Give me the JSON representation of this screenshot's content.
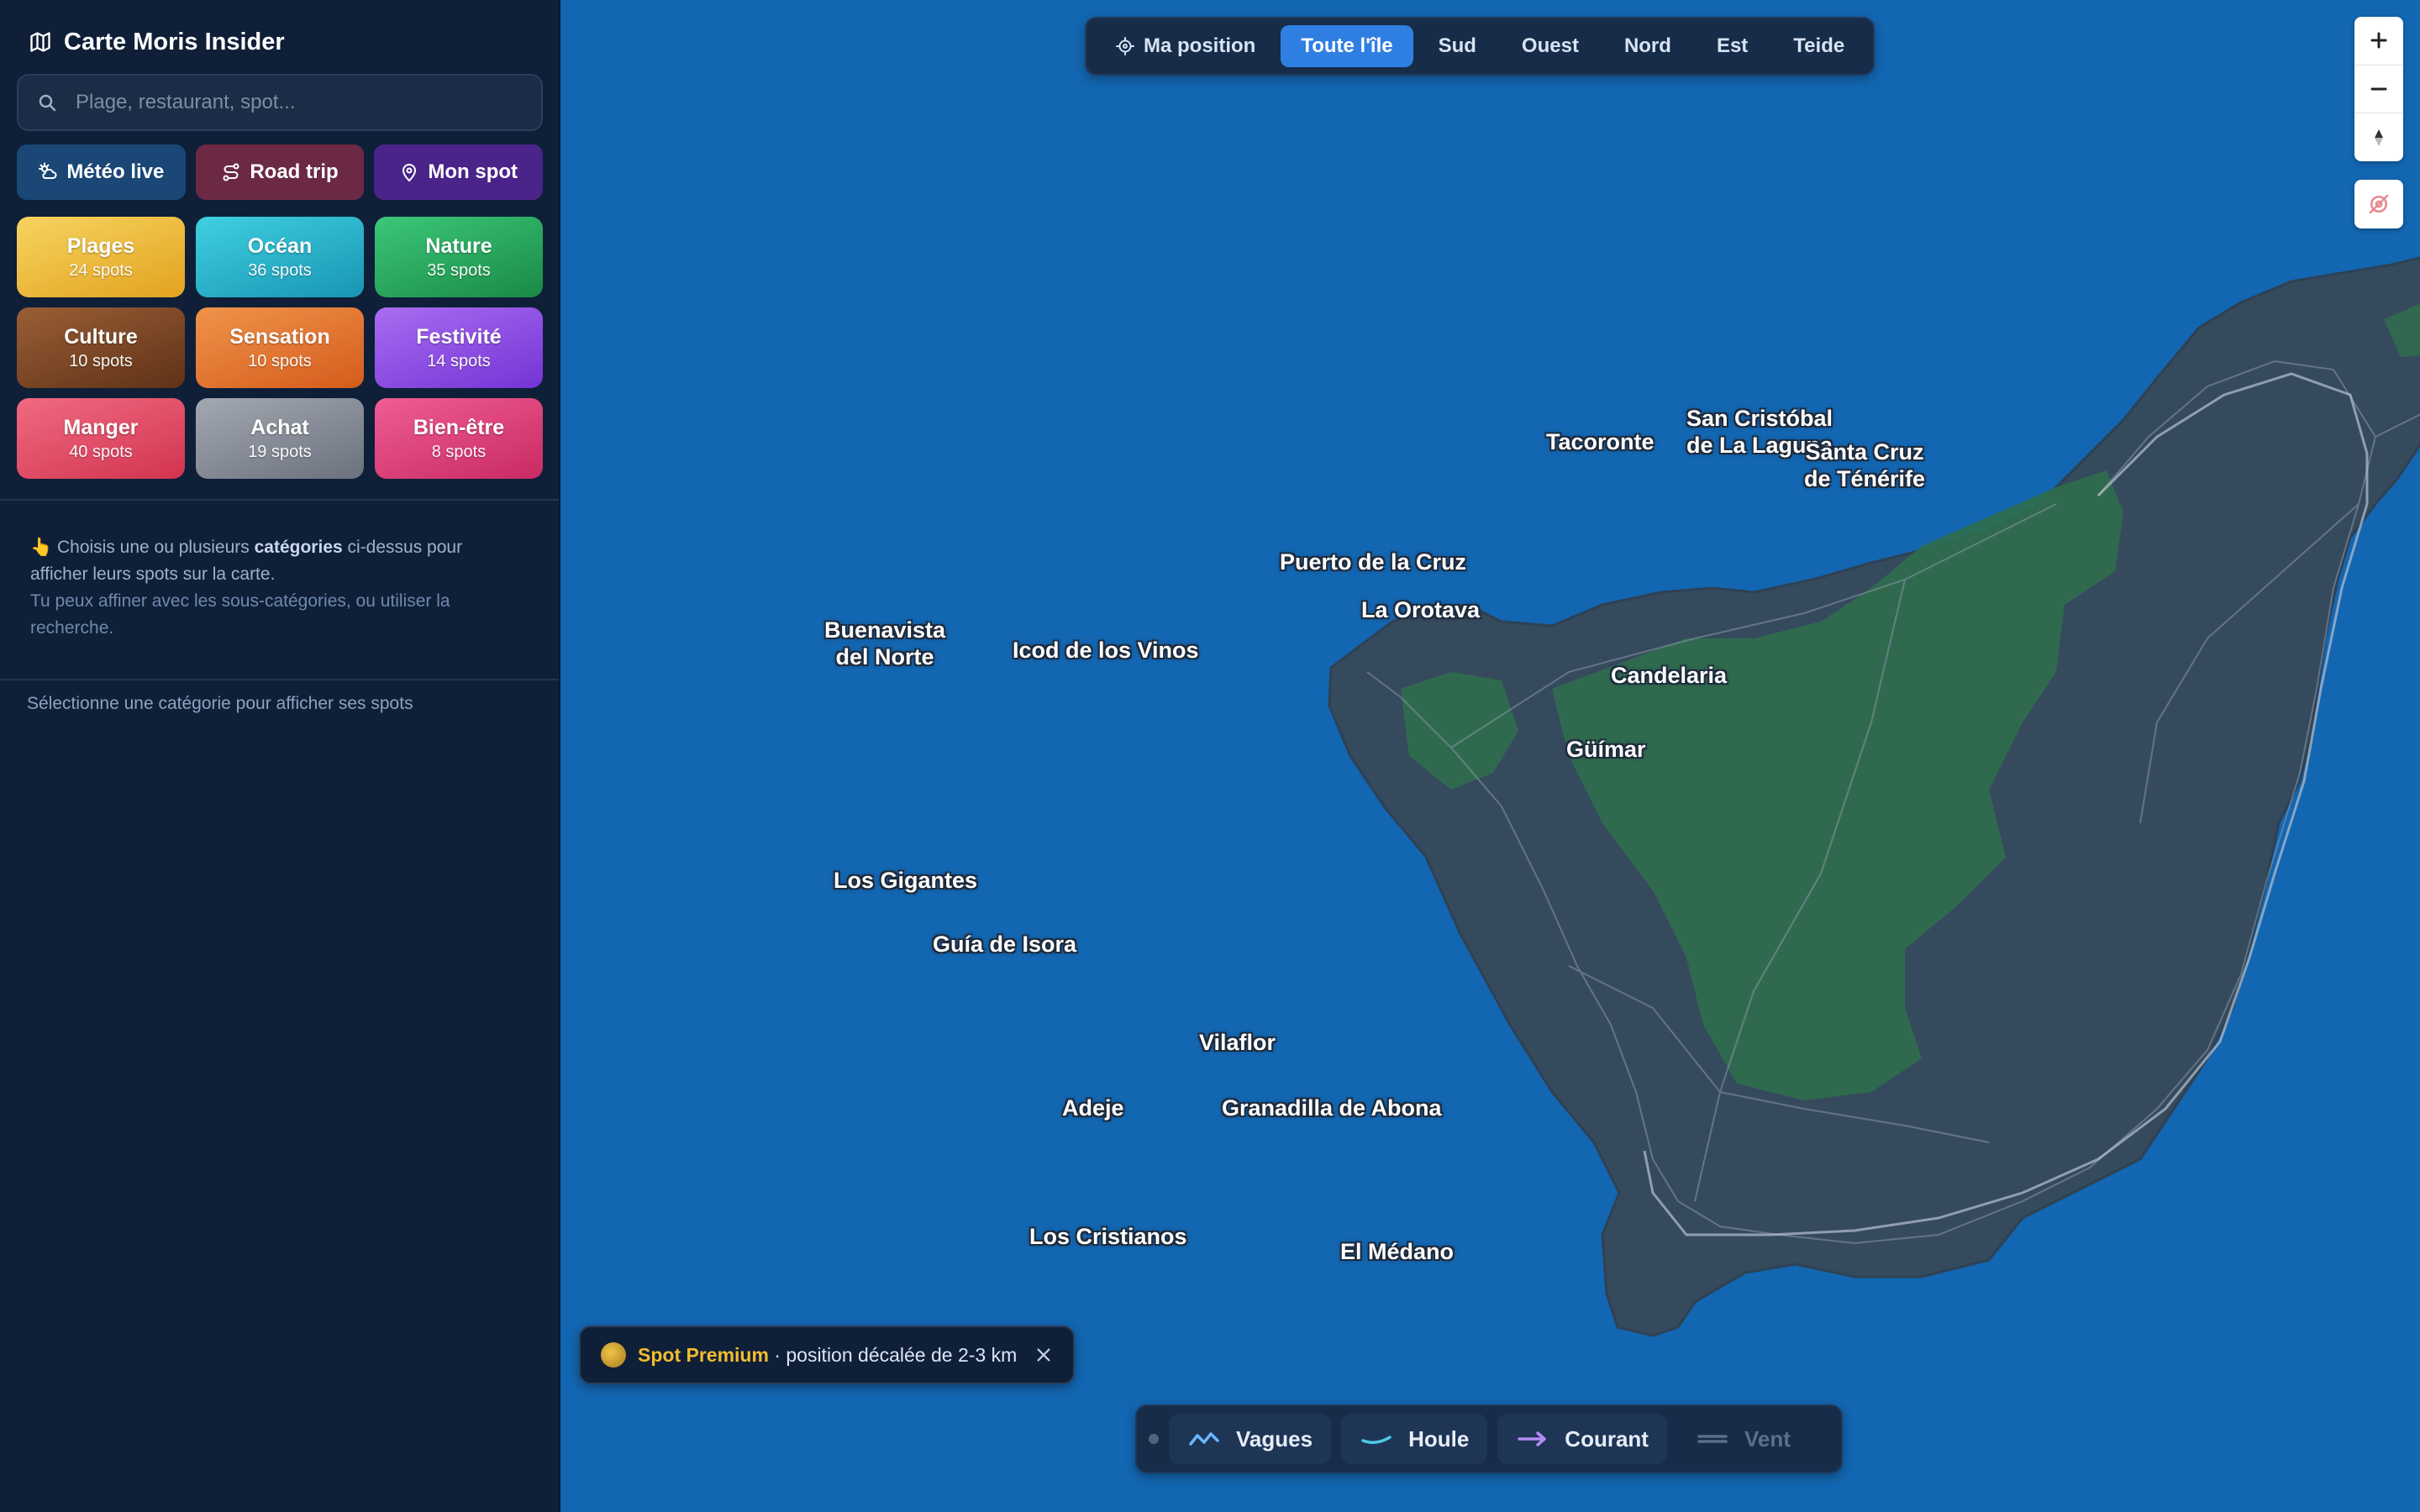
{
  "sidebar": {
    "title": "Carte Moris Insider",
    "search_placeholder": "Plage, restaurant, spot...",
    "quick_actions": [
      {
        "label": "Météo live",
        "icon": "weather-icon"
      },
      {
        "label": "Road trip",
        "icon": "route-icon"
      },
      {
        "label": "Mon spot",
        "icon": "pin-icon"
      }
    ],
    "categories": [
      {
        "name": "Plages",
        "count": "24 spots",
        "color": "#f0b52c"
      },
      {
        "name": "Océan",
        "count": "36 spots",
        "color": "#1fa8c4"
      },
      {
        "name": "Nature",
        "count": "35 spots",
        "color": "#22a45a"
      },
      {
        "name": "Culture",
        "count": "10 spots",
        "color": "#7a4422"
      },
      {
        "name": "Sensation",
        "count": "10 spots",
        "color": "#e0702a"
      },
      {
        "name": "Festivité",
        "count": "14 spots",
        "color": "#8a48e0"
      },
      {
        "name": "Manger",
        "count": "40 spots",
        "color": "#e0435e"
      },
      {
        "name": "Achat",
        "count": "19 spots",
        "color": "#7f8592"
      },
      {
        "name": "Bien-être",
        "count": "8 spots",
        "color": "#d93d77"
      }
    ],
    "hint": {
      "emoji": "👆",
      "text_before": " Choisis une ou plusieurs ",
      "bold": "catégories",
      "text_after": " ci-dessus pour afficher leurs spots sur la carte.",
      "sub": "Tu peux affiner avec les sous-catégories, ou utiliser la recherche."
    },
    "empty_message": "Sélectionne une catégorie pour afficher ses spots"
  },
  "map": {
    "zones": [
      {
        "label": "Ma position",
        "icon": "locate-icon",
        "active": false
      },
      {
        "label": "Toute l'île",
        "active": true
      },
      {
        "label": "Sud",
        "active": false
      },
      {
        "label": "Ouest",
        "active": false
      },
      {
        "label": "Nord",
        "active": false
      },
      {
        "label": "Est",
        "active": false
      },
      {
        "label": "Teide",
        "active": false
      }
    ],
    "cities": [
      {
        "line1": "Tacoronte",
        "line2": ""
      },
      {
        "line1": "San Cristóbal",
        "line2": "de La Laguna"
      },
      {
        "line1": "Santa Cruz",
        "line2": "de Ténérife"
      },
      {
        "line1": "Puerto de la Cruz",
        "line2": ""
      },
      {
        "line1": "La Orotava",
        "line2": ""
      },
      {
        "line1": "Buenavista",
        "line2": "del Norte"
      },
      {
        "line1": "Icod de los Vinos",
        "line2": ""
      },
      {
        "line1": "Candelaria",
        "line2": ""
      },
      {
        "line1": "Güímar",
        "line2": ""
      },
      {
        "line1": "Los Gigantes",
        "line2": ""
      },
      {
        "line1": "Guía de Isora",
        "line2": ""
      },
      {
        "line1": "Vilaflor",
        "line2": ""
      },
      {
        "line1": "Adeje",
        "line2": ""
      },
      {
        "line1": "Granadilla de Abona",
        "line2": ""
      },
      {
        "line1": "Los Cristianos",
        "line2": ""
      },
      {
        "line1": "El Médano",
        "line2": ""
      }
    ],
    "premium_notice": {
      "label": "Spot Premium",
      "text": " · position décalée de 2-3 km"
    },
    "layers": [
      {
        "label": "Vagues",
        "icon": "wave-icon",
        "active": true
      },
      {
        "label": "Houle",
        "icon": "swell-icon",
        "active": true
      },
      {
        "label": "Courant",
        "icon": "current-arrow-icon",
        "active": true
      },
      {
        "label": "Vent",
        "icon": "wind-icon",
        "active": false
      }
    ],
    "colors": {
      "ocean": "#1366b1",
      "land": "#364a5e",
      "forest": "#2f6e4c",
      "accent": "#2f7fe3"
    }
  }
}
